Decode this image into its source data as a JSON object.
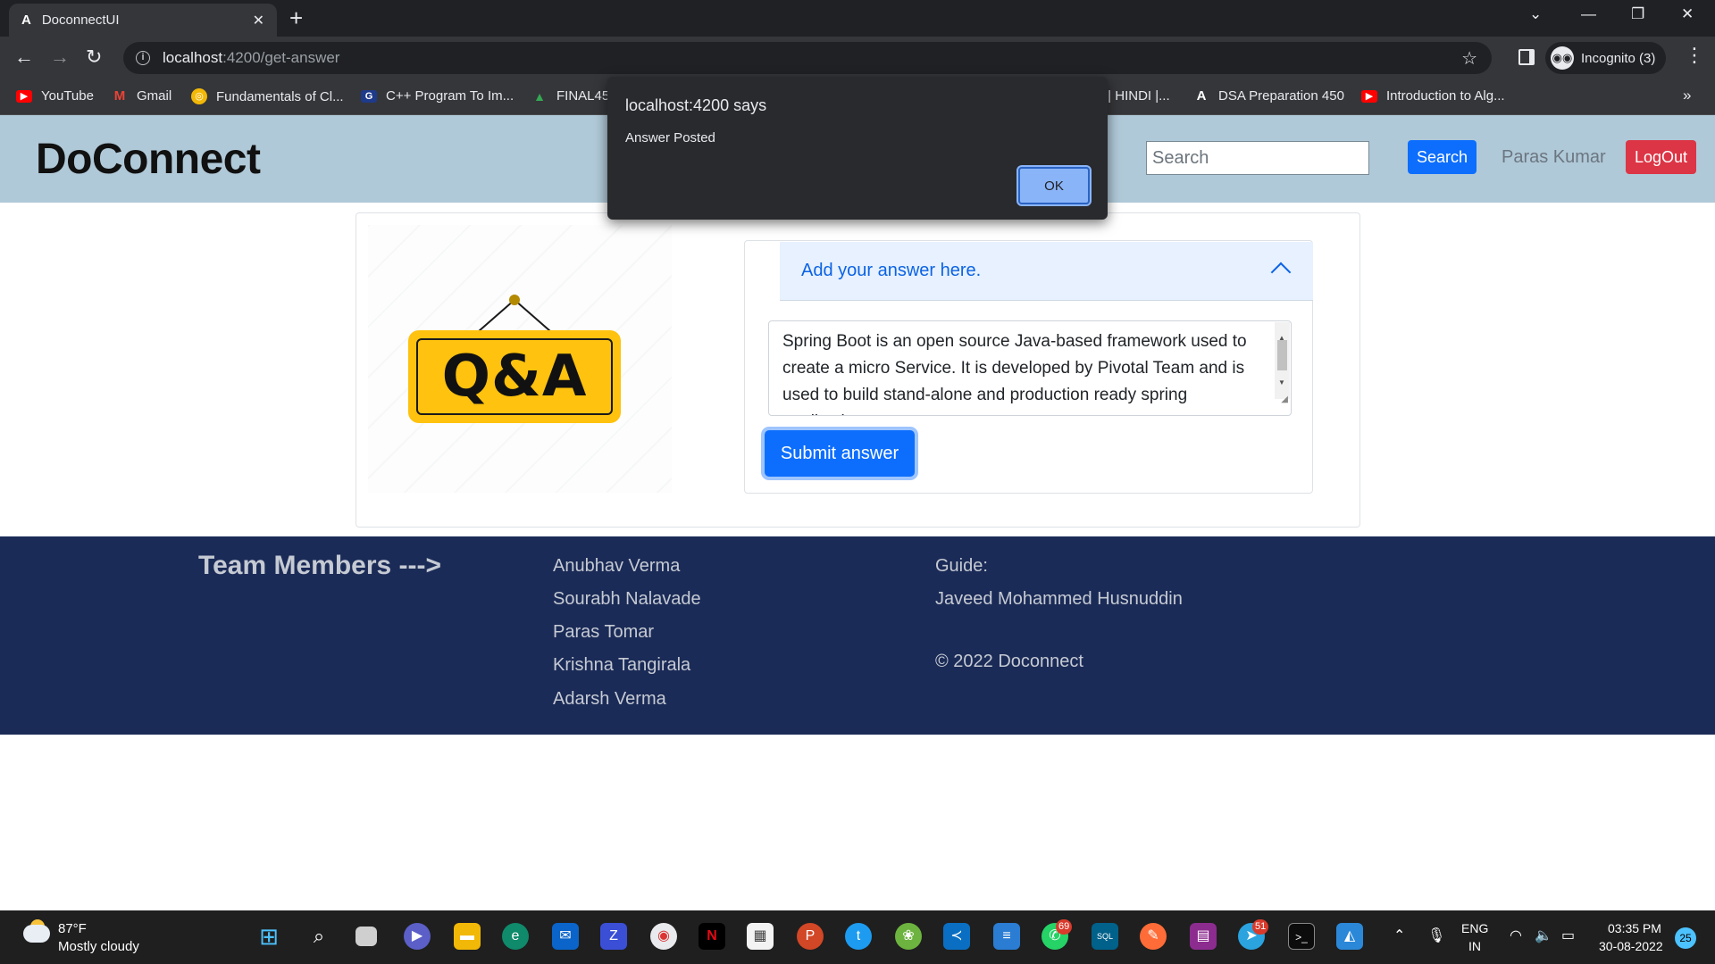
{
  "browser": {
    "tab_title": "DoconnectUI",
    "tab_favicon": "A",
    "tab_close": "✕",
    "new_tab": "+",
    "url_host": "localhost",
    "url_path": ":4200/get-answer",
    "profile_label": "Incognito (3)",
    "bookmarks": [
      {
        "label": "YouTube",
        "icon": "youtube-icon",
        "color": "#ff0000"
      },
      {
        "label": "Gmail",
        "icon": "gmail-icon",
        "color": "#ea4335"
      },
      {
        "label": "Fundamentals of Cl...",
        "icon": "coursera-icon",
        "color": "#f2b807"
      },
      {
        "label": "C++ Program To Im...",
        "icon": "gfg-icon",
        "color": "#1e3a8a"
      },
      {
        "label": "FINAL45",
        "icon": "drive-icon",
        "color": "#34a853"
      },
      {
        "label": "S | HINDI |...",
        "icon": "bookmark-icon",
        "color": "#555555"
      },
      {
        "label": "DSA Preparation 450",
        "icon": "angular-icon",
        "color": "#202124"
      },
      {
        "label": "Introduction to Alg...",
        "icon": "youtube-icon",
        "color": "#ff0000"
      }
    ],
    "bookmarks_more": "»"
  },
  "app": {
    "brand": "DoConnect",
    "search_placeholder": "Search",
    "search_button": "Search",
    "user_name": "Paras Kumar",
    "logout_button": "LogOut"
  },
  "main": {
    "illustration_text": "Q&A",
    "accordion_title": "Add your answer here.",
    "answer_text": "Spring Boot is an open source Java-based framework used to create a micro Service. It is developed by Pivotal Team and is used to build stand-alone and production ready spring applications.",
    "submit_button": "Submit answer"
  },
  "footer": {
    "team_heading": "Team Members --->",
    "members": [
      "Anubhav Verma",
      "Sourabh Nalavade",
      "Paras Tomar",
      "Krishna Tangirala",
      "Adarsh Verma"
    ],
    "guide_label": "Guide:",
    "guide_name": "Javeed Mohammed Husnuddin",
    "copyright": "© 2022 Doconnect"
  },
  "dialog": {
    "title": "localhost:4200 says",
    "message": "Answer Posted",
    "ok_button": "OK"
  },
  "taskbar": {
    "temperature": "87°F",
    "weather": "Mostly cloudy",
    "whatsapp_badge": "69",
    "telegram_badge": "51",
    "lang_line1": "ENG",
    "lang_line2": "IN",
    "time": "03:35 PM",
    "date": "30-08-2022",
    "notification_count": "25"
  },
  "colors": {
    "navbar_bg": "#b0c9d8",
    "footer_bg": "#1b2b57",
    "primary": "#0d6efd",
    "danger": "#dc3545",
    "qa_yellow": "#ffc20e"
  }
}
